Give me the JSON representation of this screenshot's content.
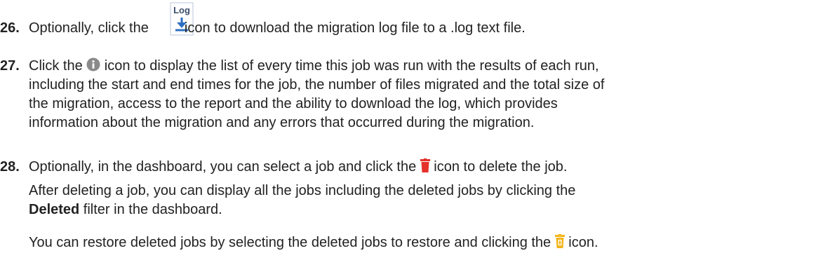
{
  "steps": [
    {
      "number": "26.",
      "before": "Optionally, click the ",
      "after": " icon to download the migration log file to a .log text file."
    },
    {
      "number": "27.",
      "line1_before": "Click the ",
      "line1_after": " icon to display the list of every time this job was run with the results of each run,",
      "line2": "including the start and end times for the job, the number of files migrated and the total size of",
      "line3": "the migration, access to the report and the ability to download the log, which provides",
      "line4": "information about the migration and any errors that occurred during the migration."
    },
    {
      "number": "28.",
      "line1_before": "Optionally, in the dashboard, you can select a job and click the ",
      "line1_after": " icon to delete the job.",
      "para2_line1": "After deleting a job, you can display all the jobs including the deleted jobs by clicking the",
      "para2_bold": "Deleted",
      "para2_after": " filter in the dashboard.",
      "para3_before": "You can restore deleted jobs by selecting the deleted jobs to restore and clicking the ",
      "para3_after": " icon."
    }
  ],
  "icons": {
    "log_icon_label": "Log",
    "log_icon_name": "download-log-icon",
    "info_icon_name": "info-icon",
    "trash_icon_name": "trash-icon",
    "restore_icon_name": "restore-icon",
    "colors": {
      "log_blue": "#2e6fc4",
      "info_gray": "#8a8a8a",
      "trash_red": "#e4312b",
      "restore_yellow": "#f3b51b"
    }
  }
}
